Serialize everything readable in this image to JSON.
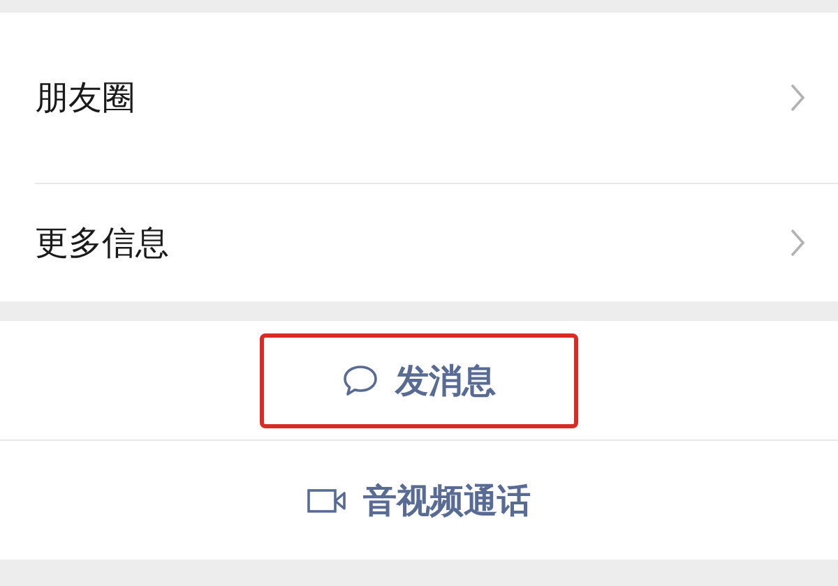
{
  "menu_items": [
    {
      "label": "朋友圈"
    },
    {
      "label": "更多信息"
    }
  ],
  "actions": [
    {
      "kind": "chat",
      "label": "发消息",
      "highlighted": true
    },
    {
      "kind": "video",
      "label": "音视频通话",
      "highlighted": false
    }
  ]
}
